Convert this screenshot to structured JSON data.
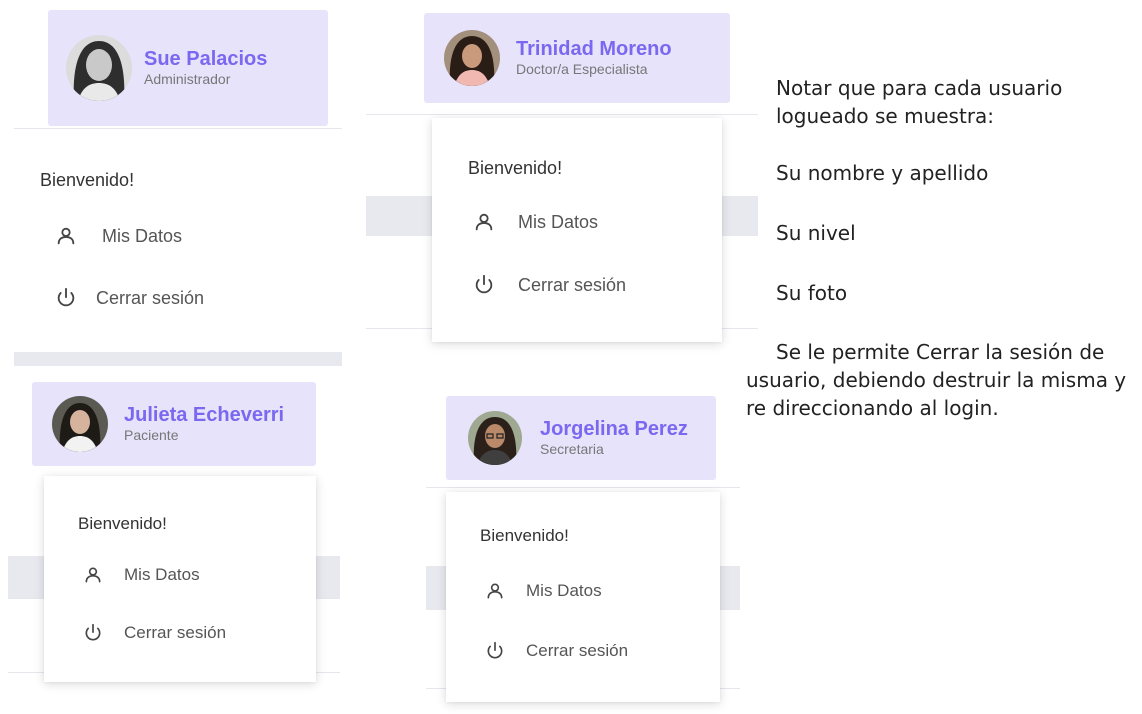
{
  "cards": [
    {
      "user_name": "Sue Palacios",
      "user_role": "Administrador",
      "welcome": "Bienvenido!",
      "menu": {
        "profile_label": "Mis Datos",
        "profile_icon": "user-icon",
        "logout_label": "Cerrar sesión",
        "logout_icon": "power-icon"
      }
    },
    {
      "user_name": "Trinidad Moreno",
      "user_role": "Doctor/a Especialista",
      "welcome": "Bienvenido!",
      "menu": {
        "profile_label": "Mis Datos",
        "profile_icon": "user-icon",
        "logout_label": "Cerrar sesión",
        "logout_icon": "power-icon"
      }
    },
    {
      "user_name": "Julieta Echeverri",
      "user_role": "Paciente",
      "welcome": "Bienvenido!",
      "menu": {
        "profile_label": "Mis Datos",
        "profile_icon": "user-icon",
        "logout_label": "Cerrar sesión",
        "logout_icon": "power-icon"
      }
    },
    {
      "user_name": "Jorgelina Perez",
      "user_role": "Secretaria",
      "welcome": "Bienvenido!",
      "menu": {
        "profile_label": "Mis Datos",
        "profile_icon": "user-icon",
        "logout_label": "Cerrar sesión",
        "logout_icon": "power-icon"
      }
    }
  ],
  "notes": {
    "intro": "Notar que para cada usuario logueado se muestra:",
    "item_name": "Su nombre y apellido",
    "item_level": "Su nivel",
    "item_photo": "Su foto",
    "logout_note": "Se le permite Cerrar la sesión de usuario, debiendo destruir la misma y re direccionando al login."
  },
  "colors": {
    "header_background": "#e6e3fb",
    "user_name": "#7a68f0",
    "user_role": "#777777",
    "menu_text": "#555555",
    "page_band": "#e8e9ef"
  }
}
